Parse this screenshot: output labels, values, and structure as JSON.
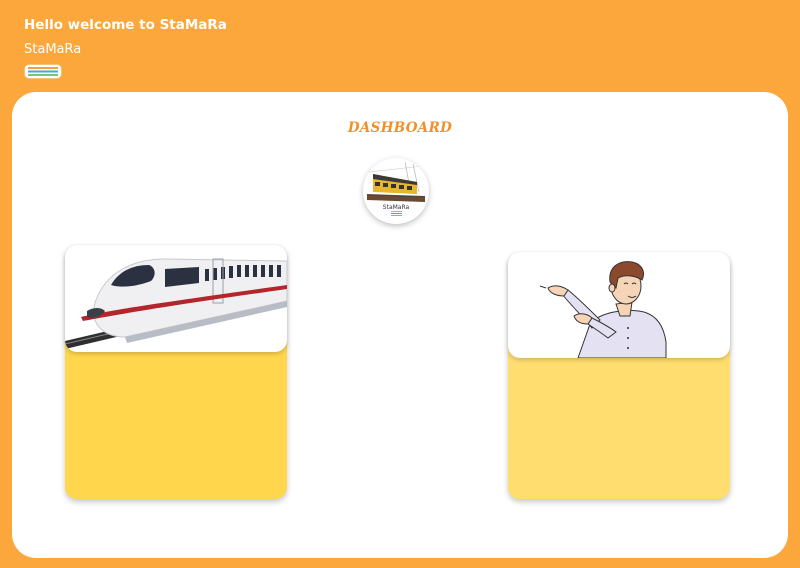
{
  "header": {
    "greeting": "Hello welcome to StaMaRa",
    "brand": "StaMaRa"
  },
  "menu": {
    "icon": "menu-stripes-icon"
  },
  "dashboard": {
    "title": "DASHBOARD",
    "logo_text": "StaMaRa"
  },
  "cards": [
    {
      "illustration": "train-illustration"
    },
    {
      "illustration": "person-presenting-illustration"
    }
  ],
  "colors": {
    "background": "#fca73c",
    "panel": "#ffffff",
    "title": "#f0902a",
    "card_left": "#ffd64c",
    "card_right": "#ffdd6e"
  }
}
